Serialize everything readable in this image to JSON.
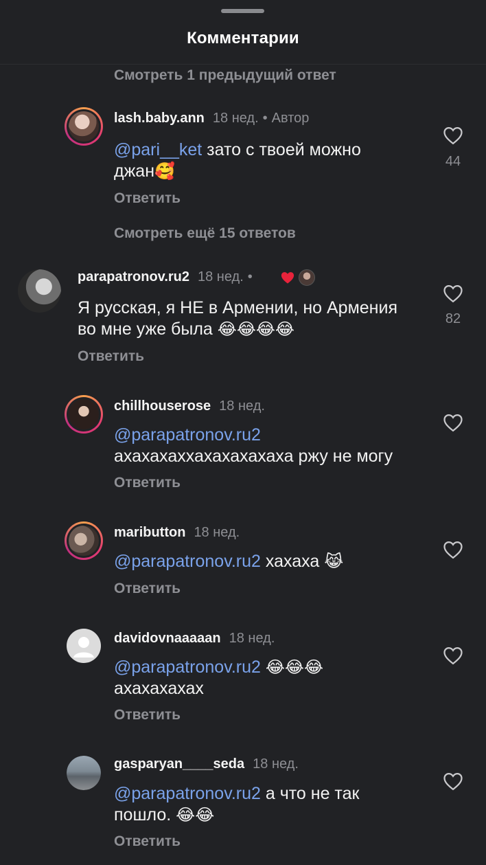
{
  "header": {
    "title": "Комментарии"
  },
  "view_previous": "Смотреть 1 предыдущий ответ",
  "view_more": "Смотреть ещё 15 ответов",
  "reply_label": "Ответить",
  "comments": [
    {
      "username": "lash.baby.ann",
      "time": "18 нед.",
      "badge": "Автор",
      "mention": "@pari__ket",
      "text": " зато с твоей можно",
      "text2": "джан",
      "emoji": "🥰",
      "likes": "44"
    },
    {
      "username": "parapatronov.ru2",
      "time": "18 нед.",
      "line1": "Я русская, я НЕ в Армении, но Армения",
      "line2": "во мне уже была ",
      "emoji": "😂😂😂😂",
      "likes": "82"
    },
    {
      "username": "chillhouserose",
      "time": "18 нед.",
      "mention": "@parapatronov.ru2",
      "text": "ахахахаххахахахахаха ржу не могу"
    },
    {
      "username": "maributton",
      "time": "18 нед.",
      "mention": "@parapatronov.ru2",
      "text": " хахаха ",
      "emoji": "😹"
    },
    {
      "username": "davidovnaaaaan",
      "time": "18 нед.",
      "mention": "@parapatronov.ru2",
      "emoji": "😂😂😂",
      "text": "ахахахахах"
    },
    {
      "username": "gasparyan____seda",
      "time": "18 нед.",
      "mention": "@parapatronov.ru2",
      "text": " а что не так",
      "text2": "пошло. ",
      "emoji": "😂😂"
    }
  ],
  "colors": {
    "background": "#212225",
    "mention": "#7aa2ea",
    "secondary_text": "#8e8f94",
    "liked_heart": "#e8233b"
  },
  "icons": {
    "like": "heart-outline-icon",
    "liked_by_author": "heart-filled-icon"
  }
}
